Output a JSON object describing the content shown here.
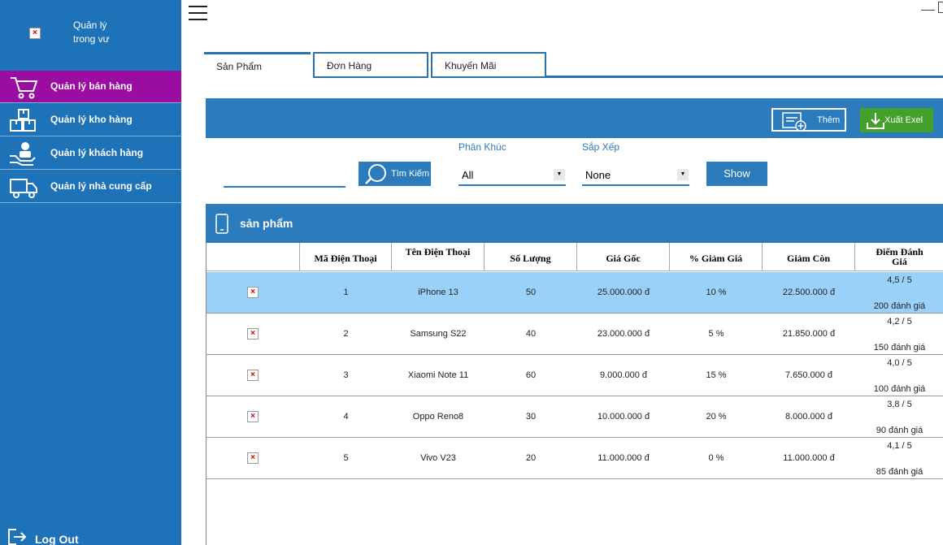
{
  "app": {
    "title_line1": "Quản lý",
    "title_line2": "trong vư",
    "logo_placeholder": "×"
  },
  "sidebar": {
    "items": [
      {
        "label": "Quản lý bán hàng",
        "icon": "cart-icon",
        "active": true
      },
      {
        "label": "Quản lý kho hàng",
        "icon": "boxes-icon",
        "active": false
      },
      {
        "label": "Quản lý khách hàng",
        "icon": "customer-icon",
        "active": false
      },
      {
        "label": "Quản lý nhà cung cấp",
        "icon": "truck-icon",
        "active": false
      }
    ],
    "logout_label": "Log Out"
  },
  "tabs": [
    {
      "label": "Sản Phẩm",
      "active": true
    },
    {
      "label": "Đơn Hàng",
      "active": false
    },
    {
      "label": "Khuyến Mãi",
      "active": false
    }
  ],
  "toolbar": {
    "add_label": "Thêm",
    "export_label": "Xuất Exel"
  },
  "filters": {
    "search_value": "",
    "search_button_label": "Tìm Kiếm",
    "segment_label": "Phân Khúc",
    "segment_value": "All",
    "sort_label": "Sắp Xếp",
    "sort_value": "None",
    "show_label": "Show"
  },
  "section": {
    "title": "sản phẩm"
  },
  "table": {
    "headers": [
      "",
      "Mã Điện Thoại",
      "Tên Điện Thoại",
      "Số Lượng",
      "Giá Gốc",
      "% Giảm Giá",
      "Giảm Còn",
      "Điểm Đánh Giá"
    ],
    "rows": [
      {
        "id": "1",
        "name": "iPhone 13",
        "qty": "50",
        "price": "25.000.000 đ",
        "discount": "10 %",
        "final": "22.500.000 đ",
        "rating": "4,5 / 5",
        "reviews": "200 đánh giá",
        "selected": true
      },
      {
        "id": "2",
        "name": "Samsung S22",
        "qty": "40",
        "price": "23.000.000 đ",
        "discount": "5 %",
        "final": "21.850.000 đ",
        "rating": "4,2 / 5",
        "reviews": "150 đánh giá",
        "selected": false
      },
      {
        "id": "3",
        "name": "Xiaomi Note 11",
        "qty": "60",
        "price": "9.000.000 đ",
        "discount": "15 %",
        "final": "7.650.000 đ",
        "rating": "4,0 / 5",
        "reviews": "100 đánh giá",
        "selected": false
      },
      {
        "id": "4",
        "name": "Oppo Reno8",
        "qty": "30",
        "price": "10.000.000 đ",
        "discount": "20 %",
        "final": "8.000.000 đ",
        "rating": "3,8 / 5",
        "reviews": "90 đánh giá",
        "selected": false
      },
      {
        "id": "5",
        "name": "Vivo V23",
        "qty": "20",
        "price": "11.000.000 đ",
        "discount": "0 %",
        "final": "11.000.000 đ",
        "rating": "4,1 / 5",
        "reviews": "85 đánh giá",
        "selected": false
      }
    ]
  },
  "colors": {
    "sidebar_bg": "#1e73b8",
    "active_nav": "#9b0ca0",
    "accent": "#2b7bbd",
    "export_green": "#43a02b",
    "selected_row": "#9ad1fa"
  }
}
